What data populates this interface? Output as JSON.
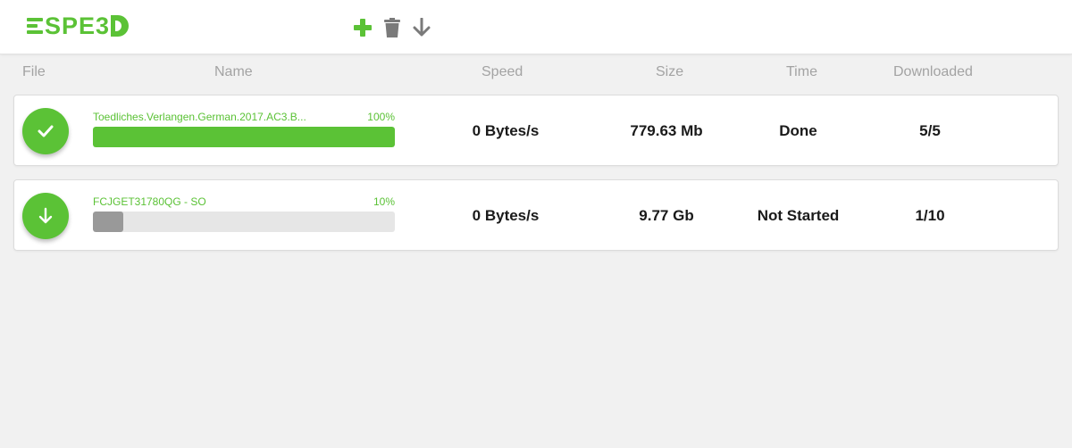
{
  "app": {
    "logo_text": "SPE3",
    "brand_color": "#5bc236"
  },
  "toolbar": {
    "add_icon": "plus-icon",
    "delete_icon": "trash-icon",
    "download_icon": "arrow-down-icon"
  },
  "columns": {
    "file": "File",
    "name": "Name",
    "speed": "Speed",
    "size": "Size",
    "time": "Time",
    "downloaded": "Downloaded"
  },
  "downloads": [
    {
      "status_icon": "checkmark-icon",
      "name": "Toedliches.Verlangen.German.2017.AC3.B...",
      "percent_label": "100%",
      "progress": 1.0,
      "progress_color": "#5bc236",
      "speed": "0 Bytes/s",
      "size": "779.63 Mb",
      "time": "Done",
      "downloaded": "5/5"
    },
    {
      "status_icon": "arrow-down-icon",
      "name": "FCJGET31780QG - SO",
      "percent_label": "10%",
      "progress": 0.1,
      "progress_color": "#999999",
      "speed": "0 Bytes/s",
      "size": "9.77 Gb",
      "time": "Not Started",
      "downloaded": "1/10"
    }
  ]
}
